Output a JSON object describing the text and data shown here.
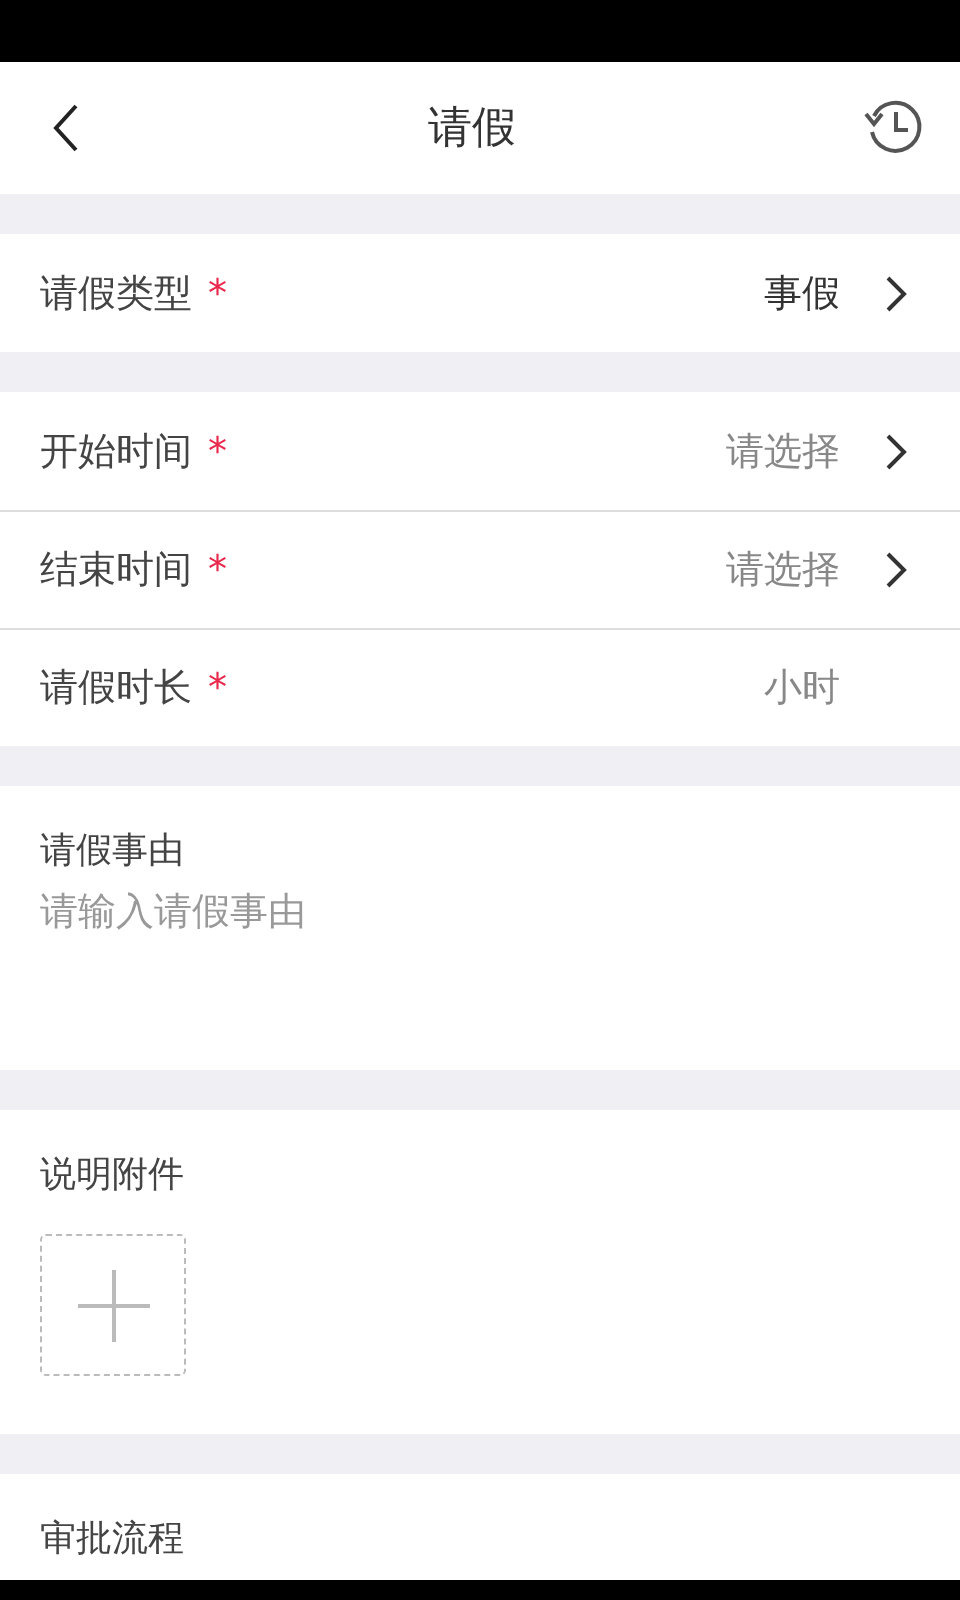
{
  "header": {
    "title": "请假"
  },
  "groups": [
    [
      {
        "kind": "select",
        "label": "请假类型",
        "required_mark": "*",
        "value": "事假"
      }
    ],
    [
      {
        "kind": "select",
        "label": "开始时间",
        "required_mark": "*",
        "placeholder": "请选择"
      },
      {
        "kind": "select",
        "label": "结束时间",
        "required_mark": "*",
        "placeholder": "请选择"
      },
      {
        "kind": "unit",
        "label": "请假时长",
        "required_mark": "*",
        "placeholder": "小时"
      }
    ]
  ],
  "reason": {
    "label": "请假事由",
    "placeholder": "请输入请假事由"
  },
  "attachment": {
    "label": "说明附件"
  },
  "approval": {
    "label": "审批流程"
  }
}
